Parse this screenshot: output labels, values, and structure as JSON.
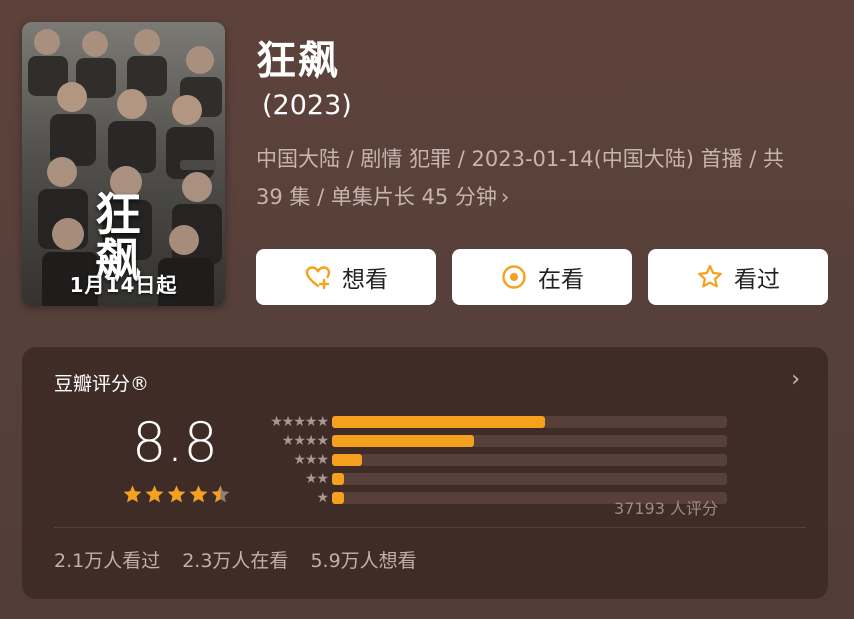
{
  "poster": {
    "title": "狂飙",
    "caption": "1月14日起"
  },
  "title": "狂飙",
  "year": "(2023)",
  "meta": {
    "line": "中国大陆 / 剧情 犯罪 / 2023-01-14(中国大陆) 首播 / 共 39 集 / 单集片长 45 分钟",
    "chevron": "›"
  },
  "buttons": [
    {
      "label": "想看",
      "icon": "heart-plus-icon"
    },
    {
      "label": "在看",
      "icon": "target-icon"
    },
    {
      "label": "看过",
      "icon": "star-outline-icon"
    }
  ],
  "rating": {
    "header": "豆瓣评分®",
    "chevron": "›",
    "score": "8.8",
    "stars_value": 4.5,
    "distribution": [
      {
        "stars": 5,
        "percent": 53.8
      },
      {
        "stars": 4,
        "percent": 36.0
      },
      {
        "stars": 3,
        "percent": 7.7
      },
      {
        "stars": 2,
        "percent": 2.8
      },
      {
        "stars": 1,
        "percent": 2.8
      }
    ],
    "count_text": "37193 人评分",
    "stats": [
      "2.1万人看过",
      "2.3万人在看",
      "5.9万人想看"
    ]
  },
  "colors": {
    "accent": "#f5a11d",
    "background": "#57403a",
    "card": "#3f2c27"
  }
}
